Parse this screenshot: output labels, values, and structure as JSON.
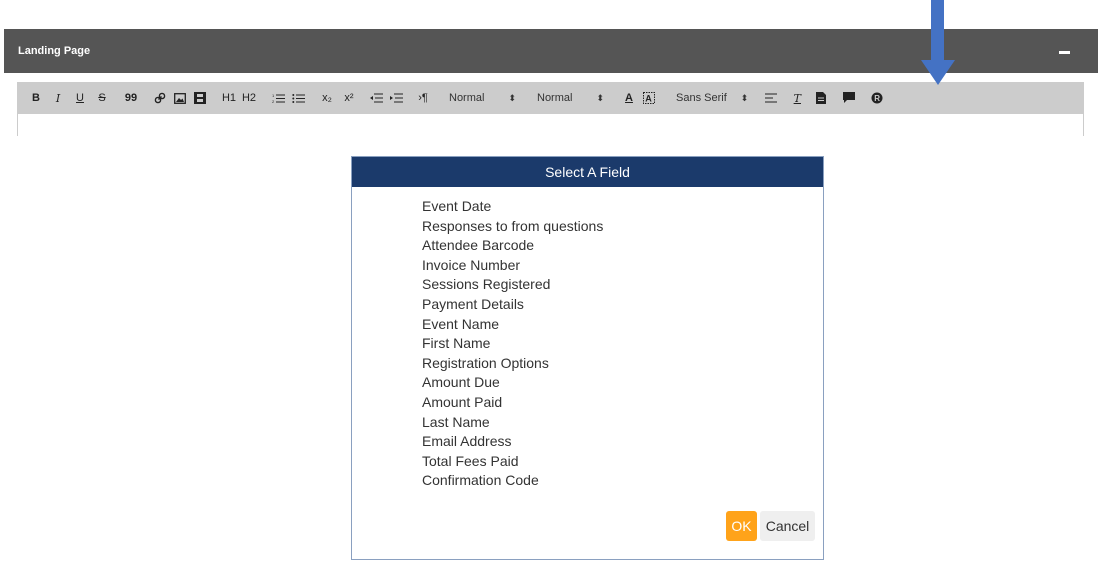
{
  "panel": {
    "title": "Landing Page",
    "collapse_icon": "minus-icon"
  },
  "toolbar": {
    "bold": "B",
    "italic": "I",
    "underline": "U",
    "strike": "S",
    "blockquote": "99",
    "link_icon": "link-icon",
    "image_icon": "image-icon",
    "video_icon": "film-icon",
    "h1": "H1",
    "h2": "H2",
    "ordered_list_icon": "ordered-list-icon",
    "bullet_list_icon": "bullet-list-icon",
    "subscript": "x₂",
    "superscript": "x²",
    "outdent_icon": "outdent-icon",
    "indent_icon": "indent-icon",
    "direction": "›¶",
    "size_select": "Normal",
    "header_select": "Normal",
    "text_color_icon": "text-color-icon",
    "background_color_icon": "background-color-icon",
    "font_select": "Sans Serif",
    "align_icon": "align-icon",
    "clean_icon": "clear-format-icon",
    "document_icon": "document-icon",
    "comment_icon": "comment-icon",
    "r_icon": "registered-icon"
  },
  "annotation": {
    "arrow_color": "#4472c4"
  },
  "dialog": {
    "title": "Select A Field",
    "fields": [
      "Event Date",
      "Responses to from questions",
      "Attendee Barcode",
      "Invoice Number",
      "Sessions Registered",
      "Payment Details",
      "Event Name",
      "First Name",
      "Registration Options",
      "Amount Due",
      "Amount Paid",
      "Last Name",
      "Email Address",
      "Total Fees Paid",
      "Confirmation Code"
    ],
    "ok_label": "OK",
    "cancel_label": "Cancel"
  },
  "colors": {
    "header_bg": "#555555",
    "toolbar_bg": "#cccccc",
    "dialog_header_bg": "#1b3a6b",
    "ok_bg": "#ffa31a",
    "cancel_bg": "#efefef"
  }
}
